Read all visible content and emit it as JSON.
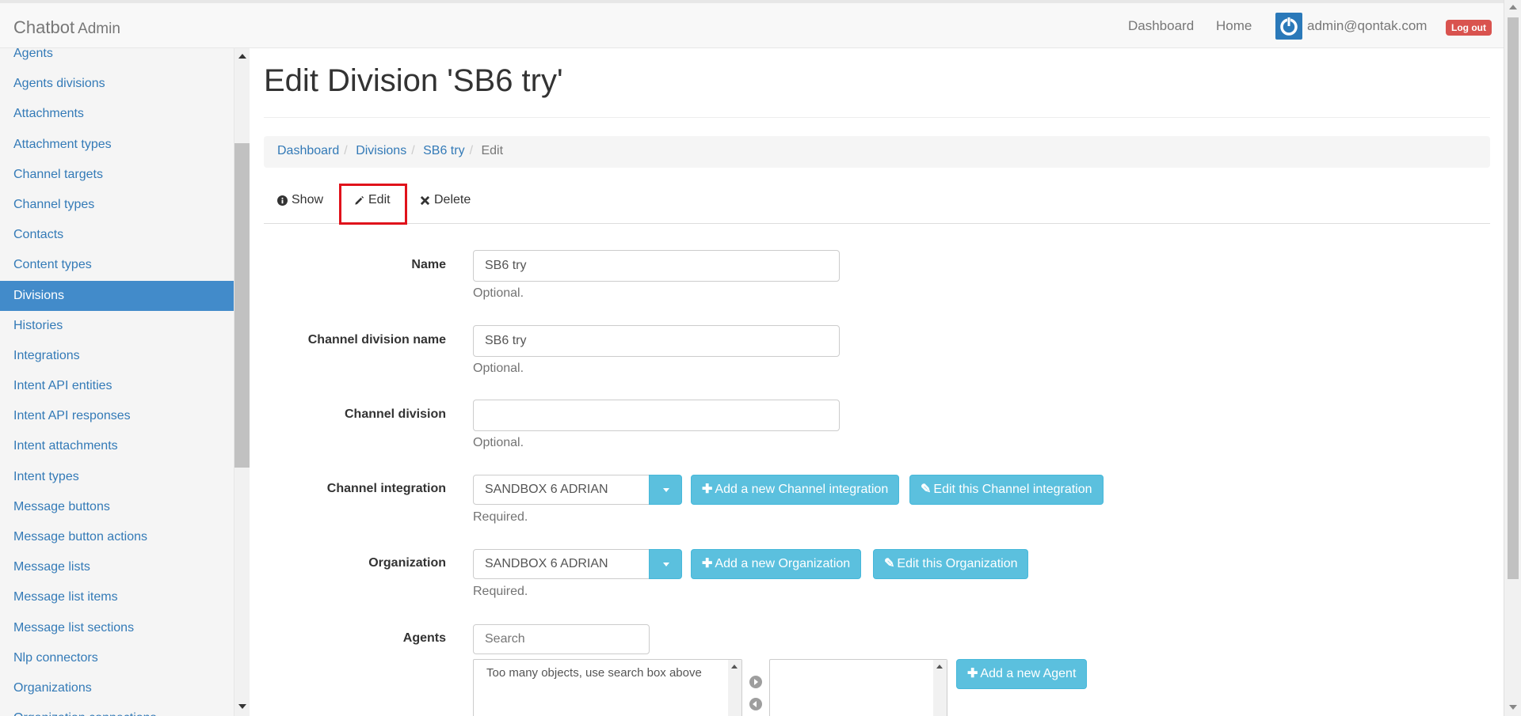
{
  "app": {
    "brand": "Chatbot",
    "brand_sub": "Admin"
  },
  "navbar": {
    "dashboard": "Dashboard",
    "home": "Home",
    "user_email": "admin@qontak.com",
    "logout": "Log out"
  },
  "sidebar": {
    "items": [
      {
        "label": "Agents"
      },
      {
        "label": "Agents divisions"
      },
      {
        "label": "Attachments"
      },
      {
        "label": "Attachment types"
      },
      {
        "label": "Channel targets"
      },
      {
        "label": "Channel types"
      },
      {
        "label": "Contacts"
      },
      {
        "label": "Content types"
      },
      {
        "label": "Divisions"
      },
      {
        "label": "Histories"
      },
      {
        "label": "Integrations"
      },
      {
        "label": "Intent API entities"
      },
      {
        "label": "Intent API responses"
      },
      {
        "label": "Intent attachments"
      },
      {
        "label": "Intent types"
      },
      {
        "label": "Message buttons"
      },
      {
        "label": "Message button actions"
      },
      {
        "label": "Message lists"
      },
      {
        "label": "Message list items"
      },
      {
        "label": "Message list sections"
      },
      {
        "label": "Nlp connectors"
      },
      {
        "label": "Organizations"
      },
      {
        "label": "Organization connections"
      }
    ],
    "active": "Divisions"
  },
  "page": {
    "title": "Edit Division 'SB6 try'"
  },
  "breadcrumb": {
    "dashboard": "Dashboard",
    "divisions": "Divisions",
    "record": "SB6 try",
    "current": "Edit"
  },
  "tabs": {
    "show": "Show",
    "edit": "Edit",
    "delete": "Delete"
  },
  "form": {
    "name": {
      "label": "Name",
      "value": "SB6 try",
      "help": "Optional."
    },
    "channel_division_name": {
      "label": "Channel division name",
      "value": "SB6 try",
      "help": "Optional."
    },
    "channel_division": {
      "label": "Channel division",
      "value": "",
      "help": "Optional."
    },
    "channel_integration": {
      "label": "Channel integration",
      "selected": "SANDBOX 6 ADRIAN",
      "add_button": "Add a new Channel integration",
      "edit_button": "Edit this Channel integration",
      "help": "Required."
    },
    "organization": {
      "label": "Organization",
      "selected": "SANDBOX 6 ADRIAN",
      "add_button": "Add a new Organization",
      "edit_button": "Edit this Organization",
      "help": "Required."
    },
    "agents": {
      "label": "Agents",
      "search_placeholder": "Search",
      "available_message": "Too many objects, use search box above",
      "add_button": "Add a new Agent"
    }
  },
  "colors": {
    "link": "#337ab7",
    "active_sidebar": "#428bca",
    "info_button": "#5bc0de",
    "danger": "#d9534f",
    "highlight": "#e0121b"
  }
}
